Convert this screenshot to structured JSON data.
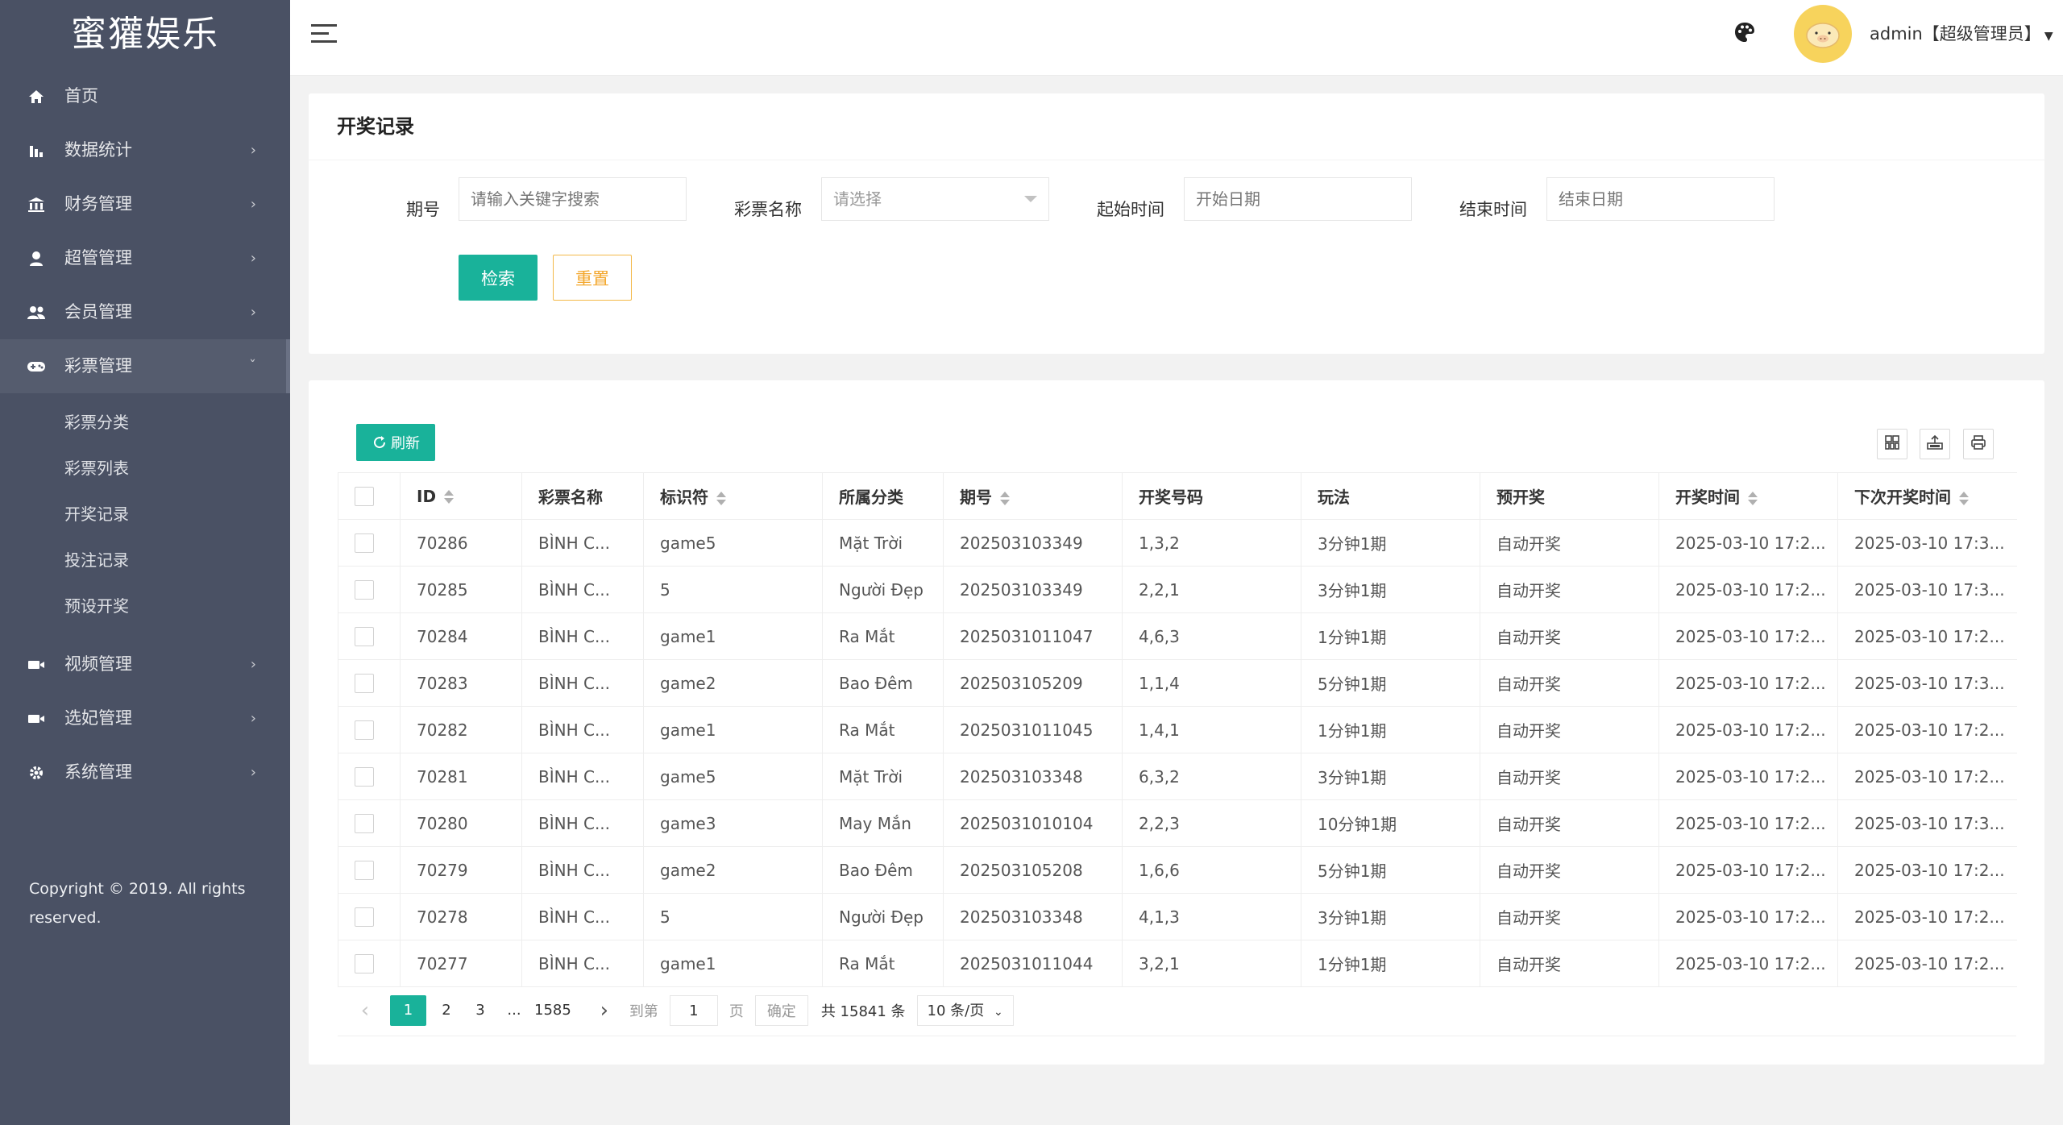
{
  "brand": {
    "name": "蜜獾娱乐"
  },
  "sidebar": {
    "items": [
      {
        "label": "首页",
        "icon": "home-icon",
        "has_arrow": false
      },
      {
        "label": "数据统计",
        "icon": "bar-chart-icon",
        "has_arrow": true
      },
      {
        "label": "财务管理",
        "icon": "bank-icon",
        "has_arrow": true
      },
      {
        "label": "超管管理",
        "icon": "user-icon",
        "has_arrow": true
      },
      {
        "label": "会员管理",
        "icon": "users-icon",
        "has_arrow": true
      },
      {
        "label": "彩票管理",
        "icon": "gamepad-icon",
        "has_arrow": true,
        "active": true
      }
    ],
    "subitems": [
      "彩票分类",
      "彩票列表",
      "开奖记录",
      "投注记录",
      "预设开奖"
    ],
    "items_after": [
      {
        "label": "视频管理",
        "icon": "video-icon"
      },
      {
        "label": "选妃管理",
        "icon": "video-icon"
      },
      {
        "label": "系统管理",
        "icon": "gear-icon"
      }
    ],
    "copyright": "Copyright © 2019. All rights reserved."
  },
  "header": {
    "user": "admin【超级管理员】"
  },
  "search": {
    "title": "开奖记录",
    "period_label": "期号",
    "period_placeholder": "请输入关键字搜索",
    "lottery_label": "彩票名称",
    "lottery_placeholder": "请选择",
    "start_label": "起始时间",
    "start_placeholder": "开始日期",
    "end_label": "结束时间",
    "end_placeholder": "结束日期",
    "search_btn": "检索",
    "reset_btn": "重置"
  },
  "table": {
    "refresh_btn": "刷新",
    "columns": [
      "ID",
      "彩票名称",
      "标识符",
      "所属分类",
      "期号",
      "开奖号码",
      "玩法",
      "预开奖",
      "开奖时间",
      "下次开奖时间"
    ],
    "rows": [
      [
        "70286",
        "BÌNH C...",
        "game5",
        "Mặt Trời",
        "202503103349",
        "1,3,2",
        "3分钟1期",
        "自动开奖",
        "2025-03-10 17:2...",
        "2025-03-10 17:3..."
      ],
      [
        "70285",
        "BÌNH C...",
        "5",
        "Người Đẹp",
        "202503103349",
        "2,2,1",
        "3分钟1期",
        "自动开奖",
        "2025-03-10 17:2...",
        "2025-03-10 17:3..."
      ],
      [
        "70284",
        "BÌNH C...",
        "game1",
        "Ra Mắt",
        "2025031011047",
        "4,6,3",
        "1分钟1期",
        "自动开奖",
        "2025-03-10 17:2...",
        "2025-03-10 17:2..."
      ],
      [
        "70283",
        "BÌNH C...",
        "game2",
        "Bao Đêm",
        "202503105209",
        "1,1,4",
        "5分钟1期",
        "自动开奖",
        "2025-03-10 17:2...",
        "2025-03-10 17:3..."
      ],
      [
        "70282",
        "BÌNH C...",
        "game1",
        "Ra Mắt",
        "2025031011045",
        "1,4,1",
        "1分钟1期",
        "自动开奖",
        "2025-03-10 17:2...",
        "2025-03-10 17:2..."
      ],
      [
        "70281",
        "BÌNH C...",
        "game5",
        "Mặt Trời",
        "202503103348",
        "6,3,2",
        "3分钟1期",
        "自动开奖",
        "2025-03-10 17:2...",
        "2025-03-10 17:2..."
      ],
      [
        "70280",
        "BÌNH C...",
        "game3",
        "May Mắn",
        "2025031010104",
        "2,2,3",
        "10分钟1期",
        "自动开奖",
        "2025-03-10 17:2...",
        "2025-03-10 17:3..."
      ],
      [
        "70279",
        "BÌNH C...",
        "game2",
        "Bao Đêm",
        "202503105208",
        "1,6,6",
        "5分钟1期",
        "自动开奖",
        "2025-03-10 17:2...",
        "2025-03-10 17:2..."
      ],
      [
        "70278",
        "BÌNH C...",
        "5",
        "Người Đẹp",
        "202503103348",
        "4,1,3",
        "3分钟1期",
        "自动开奖",
        "2025-03-10 17:2...",
        "2025-03-10 17:2..."
      ],
      [
        "70277",
        "BÌNH C...",
        "game1",
        "Ra Mắt",
        "2025031011044",
        "3,2,1",
        "1分钟1期",
        "自动开奖",
        "2025-03-10 17:2...",
        "2025-03-10 17:2..."
      ]
    ]
  },
  "pagination": {
    "current": "1",
    "pages": [
      "2",
      "3"
    ],
    "ellipsis": "...",
    "last": "1585",
    "goto_label": "到第",
    "goto_value": "1",
    "page_unit": "页",
    "confirm": "确定",
    "total": "共 15841 条",
    "page_size": "10 条/页"
  },
  "colors": {
    "accent": "#19b29a",
    "sidebar": "#4a5164",
    "warning": "#f3a72c"
  }
}
